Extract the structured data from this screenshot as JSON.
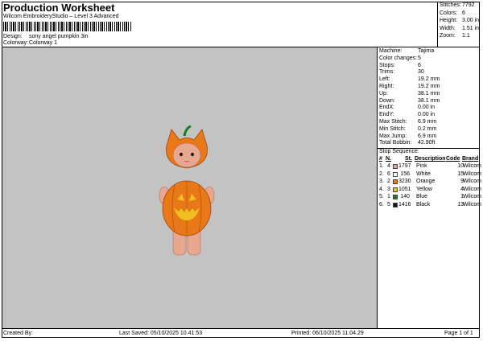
{
  "header": {
    "title": "Production Worksheet",
    "subtitle": "Wilcom EmbroideryStudio – Level 3 Advanced",
    "design_label": "Design:",
    "design_value": "sony angel pumpkin 3in",
    "colorway_label": "Colorway:",
    "colorway_value": "Colorway 1"
  },
  "top_stats": [
    {
      "label": "Stitches:",
      "value": "7792"
    },
    {
      "label": "Colors:",
      "value": "6"
    },
    {
      "label": "Height:",
      "value": "3.00 in"
    },
    {
      "label": "Width:",
      "value": "1.51 in"
    },
    {
      "label": "Zoom:",
      "value": "1:1"
    }
  ],
  "machine_info": [
    {
      "label": "Machine:",
      "value": "Tajima"
    },
    {
      "label": "Color changes:",
      "value": "5"
    },
    {
      "label": "Stops:",
      "value": "6"
    },
    {
      "label": "Trims:",
      "value": "30"
    },
    {
      "label": "Left:",
      "value": "19.2 mm"
    },
    {
      "label": "Right:",
      "value": "19.2 mm"
    },
    {
      "label": "Up:",
      "value": "38.1 mm"
    },
    {
      "label": "Down:",
      "value": "38.1 mm"
    },
    {
      "label": "EndX:",
      "value": "0.00 in"
    },
    {
      "label": "EndY:",
      "value": "0.00 in"
    },
    {
      "label": "Max Stitch:",
      "value": "6.9 mm"
    },
    {
      "label": "Min Stitch:",
      "value": "0.2 mm"
    },
    {
      "label": "Max Jump:",
      "value": "6.9 mm"
    },
    {
      "label": "Total Bobbin:",
      "value": "42.90ft"
    }
  ],
  "stop_sequence": {
    "title": "Stop Sequence:",
    "headers": {
      "num": "#",
      "n": "N.",
      "st": "St.",
      "desc": "Description",
      "code": "Code",
      "brand": "Brand"
    },
    "rows": [
      {
        "num": "1.",
        "n": "4",
        "color": "#e8a0a0",
        "st": "1797",
        "desc": "Pink",
        "code": "10",
        "brand": "Wilcom"
      },
      {
        "num": "2.",
        "n": "6",
        "color": "#ffffff",
        "st": "156",
        "desc": "White",
        "code": "15",
        "brand": "Wilcom"
      },
      {
        "num": "3.",
        "n": "2",
        "color": "#e87818",
        "st": "3230",
        "desc": "Orange",
        "code": "9",
        "brand": "Wilcom"
      },
      {
        "num": "4.",
        "n": "3",
        "color": "#f0c020",
        "st": "1051",
        "desc": "Yellow",
        "code": "4",
        "brand": "Wilcom"
      },
      {
        "num": "5.",
        "n": "1",
        "color": "#108020",
        "st": "140",
        "desc": "Blue",
        "code": "1",
        "brand": "Wilcom"
      },
      {
        "num": "6.",
        "n": "5",
        "color": "#181818",
        "st": "1416",
        "desc": "Black",
        "code": "13",
        "brand": "Wilcom"
      }
    ]
  },
  "footer": {
    "created_by": "Created By:",
    "last_saved": "Last Saved: 05/10/2025 10.41.53",
    "printed": "Printed: 06/10/2025 11.04.29",
    "page": "Page 1 of 1"
  },
  "colors": {
    "canvas_bg": "#c3c3c3",
    "pumpkin_orange": "#e87818",
    "skin_pink": "#e8a890",
    "stem_green": "#108020",
    "eye_yellow": "#f0c020"
  }
}
